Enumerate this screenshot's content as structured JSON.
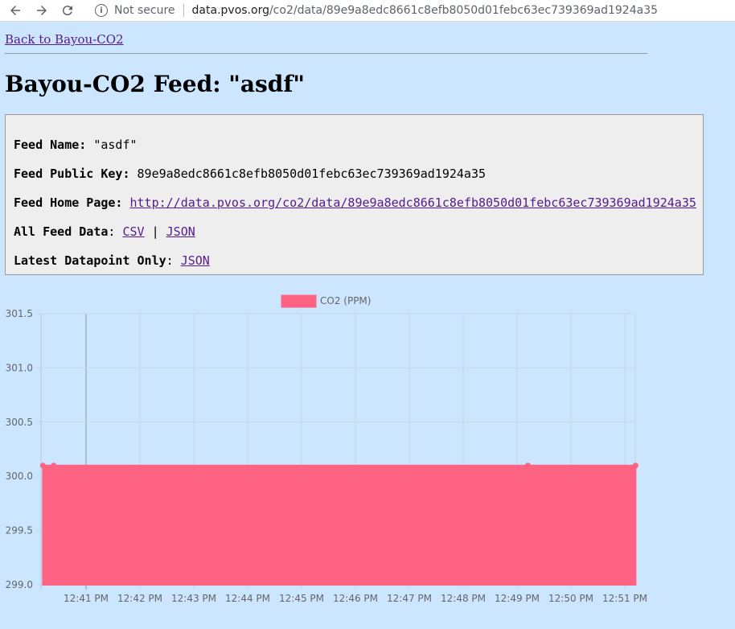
{
  "browser": {
    "security_label": "Not secure",
    "url_host": "data.pvos.org",
    "url_path": "/co2/data/89e9a8edc8661c8efb8050d01febc63ec739369ad1924a35"
  },
  "page": {
    "back_link": "Back to Bayou-CO2",
    "title": "Bayou-CO2 Feed: \"asdf\""
  },
  "feed": {
    "name_label": "Feed Name:",
    "name_value": "\"asdf\"",
    "key_label": "Feed Public Key:",
    "key_value": "89e9a8edc8661c8efb8050d01febc63ec739369ad1924a35",
    "home_label": "Feed Home Page:",
    "home_value": "http://data.pvos.org/co2/data/89e9a8edc8661c8efb8050d01febc63ec739369ad1924a35",
    "all_label": "All Feed Data",
    "csv_link": "CSV",
    "sep": "|",
    "json_link": "JSON",
    "latest_label": "Latest Datapoint Only",
    "latest_json_link": "JSON",
    "colon": ":"
  },
  "chart_data": {
    "type": "area",
    "title": "",
    "xlabel": "",
    "ylabel": "",
    "legend_position": "top",
    "ylim": [
      299.0,
      301.5
    ],
    "y_ticks": [
      "299.0",
      "299.5",
      "300.0",
      "300.5",
      "301.0",
      "301.5"
    ],
    "x_ticks": [
      "12:41 PM",
      "12:42 PM",
      "12:43 PM",
      "12:44 PM",
      "12:45 PM",
      "12:46 PM",
      "12:47 PM",
      "12:48 PM",
      "12:49 PM",
      "12:50 PM",
      "12:51 PM"
    ],
    "grid": true,
    "colors": {
      "series": "#ff6384",
      "grid": "#c8d6e2"
    },
    "series": [
      {
        "name": "CO2 (PPM)",
        "x": [
          "12:40:12 PM",
          "12:40:24 PM",
          "12:49:12 PM",
          "12:51:12 PM"
        ],
        "values": [
          300.1,
          300.1,
          300.1,
          300.1
        ]
      }
    ]
  }
}
